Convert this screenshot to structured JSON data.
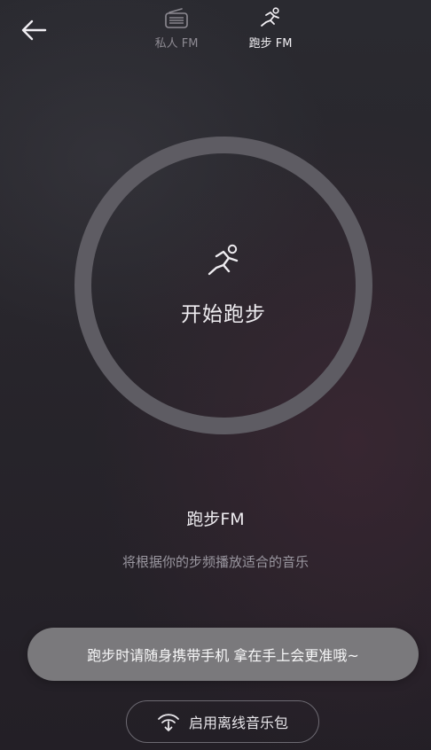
{
  "header": {
    "back_icon": "arrow-left-icon",
    "tabs": [
      {
        "label": "私人 FM",
        "icon": "radio-icon",
        "active": false
      },
      {
        "label": "跑步 FM",
        "icon": "runner-icon",
        "active": true
      }
    ]
  },
  "main": {
    "circle_icon": "runner-icon",
    "start_label": "开始跑步",
    "fm_title": "跑步FM",
    "fm_subtitle": "将根据你的步频播放适合的音乐"
  },
  "toast": {
    "text": "跑步时请随身携带手机 拿在手上会更准哦~"
  },
  "offline": {
    "icon": "wifi-download-icon",
    "label": "启用离线音乐包"
  },
  "colors": {
    "background": "#28262c",
    "ring": "#5e5c63",
    "toast_bg": "#7a797c",
    "inactive_tab": "#8d8a92",
    "active_tab": "#f2f0f4"
  }
}
